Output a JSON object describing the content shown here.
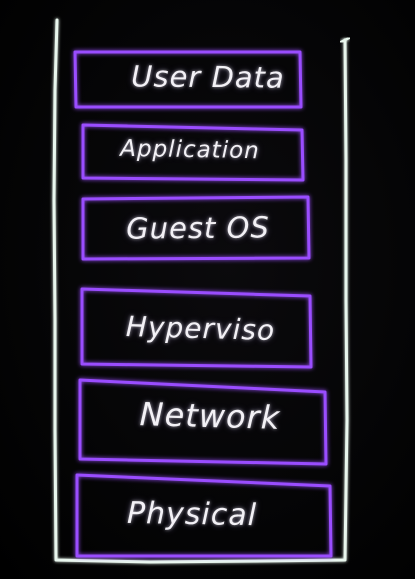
{
  "layers": [
    {
      "label": "User Data"
    },
    {
      "label": "Application"
    },
    {
      "label": "Guest OS"
    },
    {
      "label": "Hyperviso"
    },
    {
      "label": "Network"
    },
    {
      "label": "Physical"
    }
  ],
  "colors": {
    "background": "#000000",
    "outer_outline": "#e9f7ee",
    "box_outline": "#9a4dff",
    "box_glow": "#6a2bd8",
    "text": "#f3f1f6"
  }
}
